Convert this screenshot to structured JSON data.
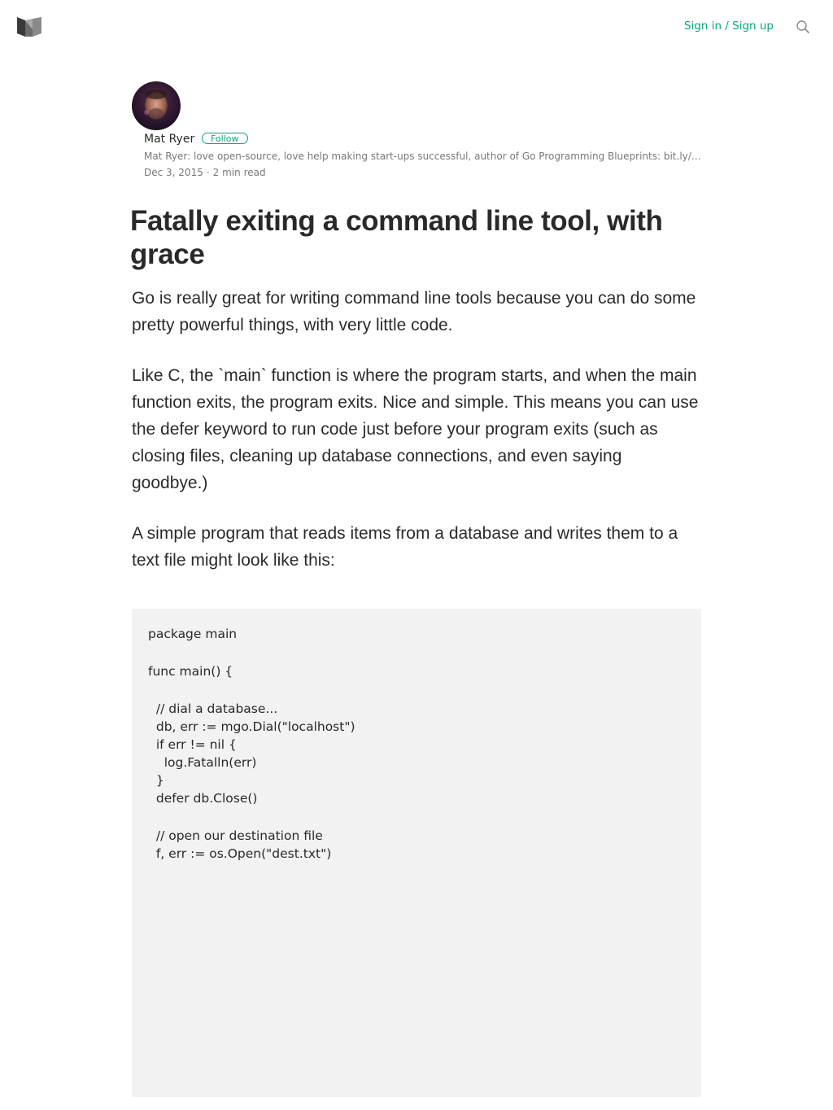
{
  "header": {
    "logo_icon": "medium-logo-icon",
    "signin_label": "Sign in / Sign up",
    "search_icon": "search-icon",
    "accent_color": "#03a87c"
  },
  "author": {
    "name": "Mat Ryer",
    "follow_label": "Follow",
    "bio": "Mat Ryer: love open-source, love help making start-ups successful, author of Go Programming Blueprints: bit.ly/goblueprints",
    "date": "Dec 3, 2015",
    "separator": "·",
    "read_time": "2 min read"
  },
  "article": {
    "title": "Fatally exiting a command line tool, with grace",
    "paragraphs": [
      "Go is really great for writing command line tools because you can do some pretty powerful things, with very little code.",
      "Like C, the `main` function is where the program starts, and when the main function exits, the program exits. Nice and simple. This means you can use the defer keyword to run code just before your program exits (such as closing files, cleaning up database connections, and even saying goodbye.)",
      "A simple program that reads items from a database and writes them to a text file might look like this:"
    ],
    "code_lines": [
      "package main",
      "",
      "func main() {",
      "",
      "  // dial a database...",
      "  db, err := mgo.Dial(\"localhost\")",
      "  if err != nil {",
      "    log.Fatalln(err)",
      "  }",
      "  defer db.Close()",
      "",
      "  // open our destination file",
      "  f, err := os.Open(\"dest.txt\")"
    ]
  }
}
